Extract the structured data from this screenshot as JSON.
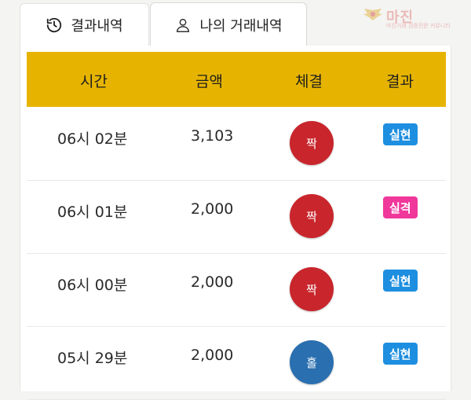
{
  "tabs": {
    "history_label": "결과내역",
    "my_trades_label": "나의 거래내역"
  },
  "watermark": {
    "title": "마진",
    "subtitle": "마진거래 검증전문 커뮤니티"
  },
  "table": {
    "headers": [
      "시간",
      "금액",
      "체결",
      "결과"
    ],
    "rows": [
      {
        "time": "06시 02분",
        "amount": "3,103",
        "bet": "짝",
        "bet_color": "#c8262c",
        "result": "실현",
        "result_color": "#1e8fe0"
      },
      {
        "time": "06시 01분",
        "amount": "2,000",
        "bet": "짝",
        "bet_color": "#c8262c",
        "result": "실격",
        "result_color": "#f0389b"
      },
      {
        "time": "06시 00분",
        "amount": "2,000",
        "bet": "짝",
        "bet_color": "#c8262c",
        "result": "실현",
        "result_color": "#1e8fe0"
      },
      {
        "time": "05시 29분",
        "amount": "2,000",
        "bet": "홀",
        "bet_color": "#2a6fb0",
        "result": "실현",
        "result_color": "#1e8fe0"
      }
    ]
  },
  "colors": {
    "header_bg": "#e6b400"
  }
}
